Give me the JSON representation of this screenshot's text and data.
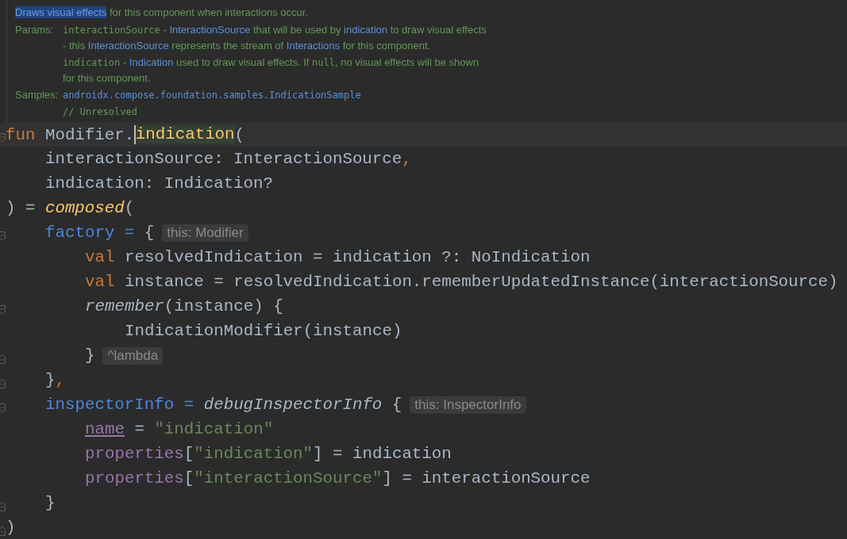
{
  "doc": {
    "description": [
      {
        "t": "Draws visual effects",
        "kind": "hl"
      },
      {
        "t": " for this component when interactions occur.",
        "kind": "text"
      }
    ],
    "sections": [
      {
        "label": "Params:",
        "lines": [
          [
            {
              "t": "interactionSource",
              "kind": "code"
            },
            {
              "t": " - ",
              "kind": "text"
            },
            {
              "t": "InteractionSource",
              "kind": "link"
            },
            {
              "t": " that will be used by ",
              "kind": "text"
            },
            {
              "t": "indication",
              "kind": "link"
            },
            {
              "t": " to draw visual effects",
              "kind": "text"
            }
          ],
          [
            {
              "t": "- this ",
              "kind": "text"
            },
            {
              "t": "InteractionSource",
              "kind": "link"
            },
            {
              "t": " represents the stream of ",
              "kind": "text"
            },
            {
              "t": "Interactions",
              "kind": "link"
            },
            {
              "t": " for this component.",
              "kind": "text"
            }
          ],
          [
            {
              "t": "indication",
              "kind": "code"
            },
            {
              "t": " - ",
              "kind": "text"
            },
            {
              "t": "Indication",
              "kind": "link"
            },
            {
              "t": " used to draw visual effects. If ",
              "kind": "text"
            },
            {
              "t": "null",
              "kind": "code"
            },
            {
              "t": ", no visual effects will be shown",
              "kind": "text"
            }
          ],
          [
            {
              "t": "for this component.",
              "kind": "text"
            }
          ]
        ]
      },
      {
        "label": "Samples:",
        "lines": [
          [
            {
              "t": "androidx.compose.foundation.samples.IndicationSample",
              "kind": "codelink"
            }
          ],
          [
            {
              "t": "// Unresolved",
              "kind": "code"
            }
          ]
        ]
      }
    ]
  },
  "code": [
    {
      "current": true,
      "fold_start": true,
      "tokens": [
        {
          "t": "fun",
          "kind": "kw"
        },
        {
          "t": " Modifier.",
          "kind": "plain"
        },
        {
          "t": "indication",
          "kind": "fn",
          "caret": true
        },
        {
          "t": "(",
          "kind": "plain"
        }
      ],
      "children": [
        {
          "tokens": [
            {
              "t": "interactionSource: InteractionSource",
              "kind": "plain"
            },
            {
              "t": ",",
              "kind": "comma"
            }
          ]
        },
        {
          "tokens": [
            {
              "t": "indication: Indication?",
              "kind": "plain"
            }
          ]
        }
      ]
    },
    {
      "tokens": [
        {
          "t": ") = ",
          "kind": "plain"
        },
        {
          "t": "composed",
          "kind": "fnit"
        },
        {
          "t": "(",
          "kind": "plain"
        }
      ],
      "children": [
        {
          "fold_start": true,
          "tokens": [
            {
              "t": "factory",
              "kind": "named"
            },
            {
              "t": " = ",
              "kind": "named"
            },
            {
              "t": "{",
              "kind": "plain"
            }
          ],
          "hint": "this: Modifier",
          "children": [
            {
              "tokens": [
                {
                  "t": "val",
                  "kind": "kw"
                },
                {
                  "t": " resolvedIndication = indication ?: NoIndication",
                  "kind": "plain"
                }
              ]
            },
            {
              "tokens": [
                {
                  "t": "val",
                  "kind": "kw"
                },
                {
                  "t": " instance = resolvedIndication.rememberUpdatedInstance(interactionSource)",
                  "kind": "plain"
                }
              ]
            },
            {
              "fold_start": true,
              "tokens": [
                {
                  "t": "remember",
                  "kind": "it"
                },
                {
                  "t": "(instance) {",
                  "kind": "plain"
                }
              ],
              "children": [
                {
                  "tokens": [
                    {
                      "t": "IndicationModifier(instance)",
                      "kind": "plain"
                    }
                  ]
                }
              ]
            },
            {
              "fold_end": true,
              "tokens": [
                {
                  "t": "}",
                  "kind": "plain"
                }
              ],
              "hint": "^lambda"
            }
          ]
        },
        {
          "fold_end": true,
          "tokens": [
            {
              "t": "}",
              "kind": "plain"
            },
            {
              "t": ",",
              "kind": "comma"
            }
          ]
        },
        {
          "fold_start": true,
          "tokens": [
            {
              "t": "inspectorInfo",
              "kind": "named"
            },
            {
              "t": " = ",
              "kind": "named"
            },
            {
              "t": "debugInspectorInfo",
              "kind": "it"
            },
            {
              "t": " {",
              "kind": "plain"
            }
          ],
          "hint": "this: InspectorInfo",
          "children": [
            {
              "tokens": [
                {
                  "t": "name",
                  "kind": "propu"
                },
                {
                  "t": " = ",
                  "kind": "plain"
                },
                {
                  "t": "\"indication\"",
                  "kind": "str"
                }
              ]
            },
            {
              "tokens": [
                {
                  "t": "properties",
                  "kind": "prop"
                },
                {
                  "t": "[",
                  "kind": "plain"
                },
                {
                  "t": "\"indication\"",
                  "kind": "str"
                },
                {
                  "t": "] = indication",
                  "kind": "plain"
                }
              ]
            },
            {
              "tokens": [
                {
                  "t": "properties",
                  "kind": "prop"
                },
                {
                  "t": "[",
                  "kind": "plain"
                },
                {
                  "t": "\"interactionSource\"",
                  "kind": "str"
                },
                {
                  "t": "] = interactionSource",
                  "kind": "plain"
                }
              ]
            }
          ]
        },
        {
          "fold_end": true,
          "tokens": [
            {
              "t": "}",
              "kind": "plain"
            }
          ]
        }
      ]
    },
    {
      "fold_end": true,
      "tokens": [
        {
          "t": ")",
          "kind": "plain"
        }
      ]
    }
  ]
}
